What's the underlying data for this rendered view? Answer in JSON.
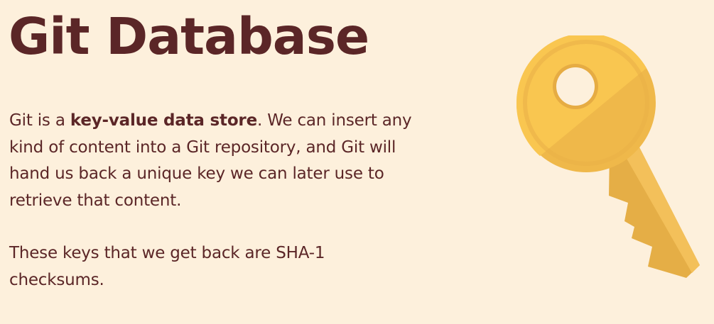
{
  "slide": {
    "title": "Git Database",
    "paragraph1": {
      "prefix": "Git is a ",
      "bold": "key-value data store",
      "suffix": ".  We can insert any kind of content into a Git repository, and Git will hand us back a unique key we can later use to retrieve that content."
    },
    "paragraph2": "These keys that we get back are SHA-1 checksums."
  },
  "illustration": {
    "icon": "key-icon",
    "colors": {
      "background": "#fdf0dc",
      "text": "#5b2627",
      "key_light": "#f9c44e",
      "key_mid": "#f1bb4c",
      "key_dark": "#e2ad45"
    }
  }
}
